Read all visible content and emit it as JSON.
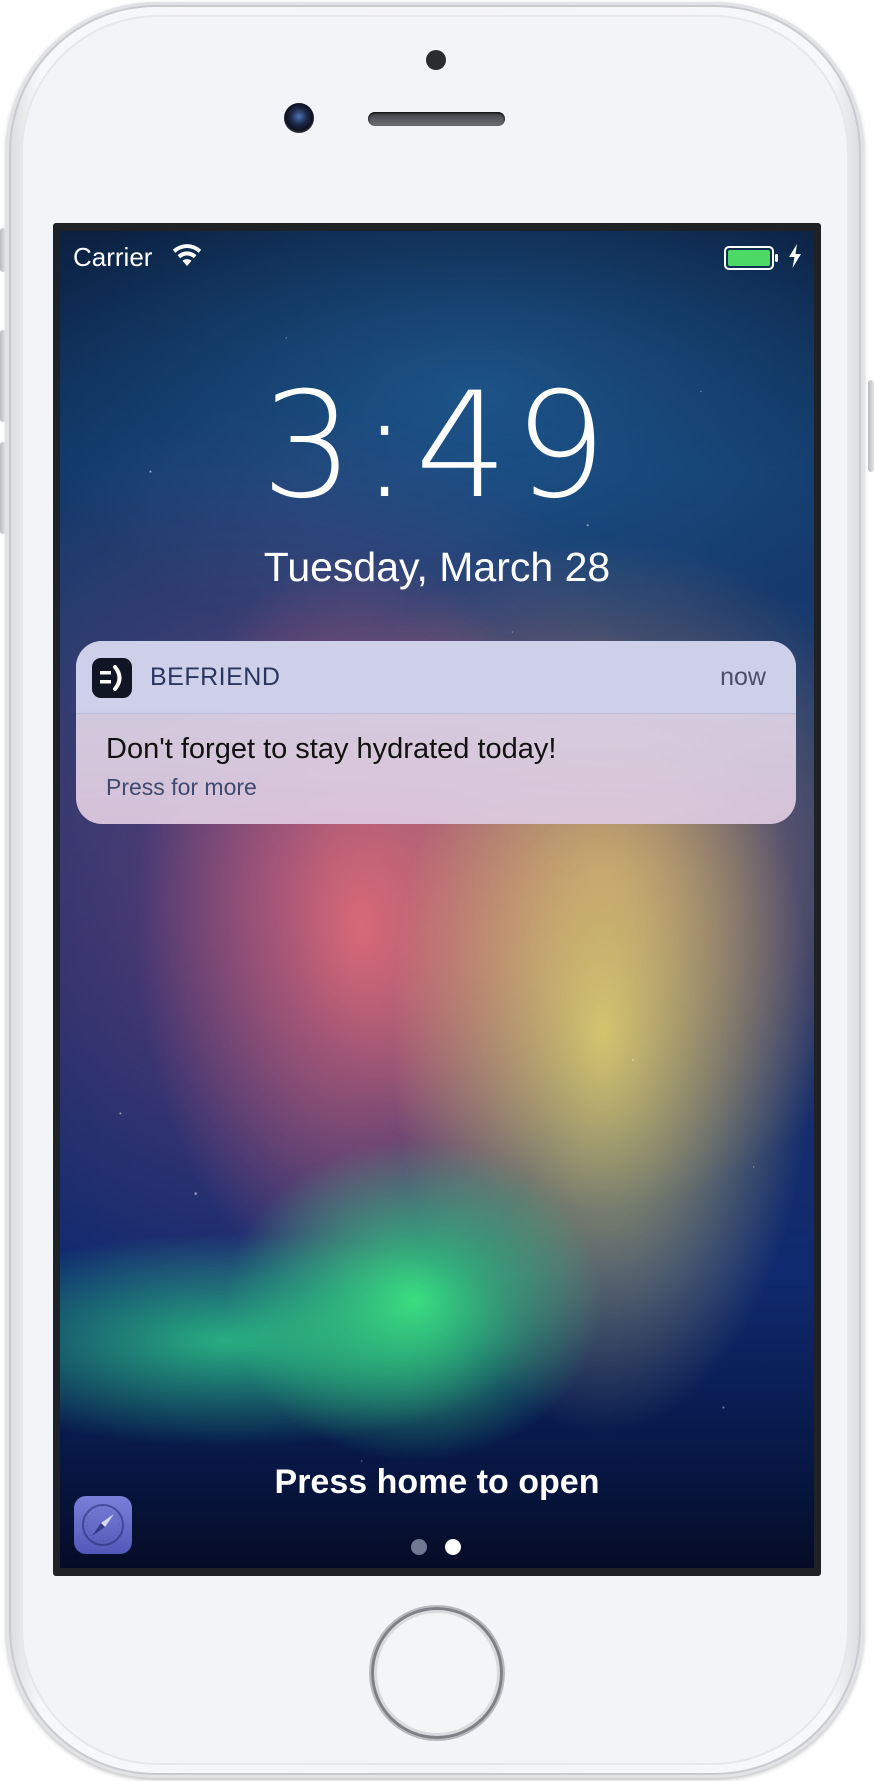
{
  "status_bar": {
    "carrier": "Carrier",
    "battery_color": "#4cd964"
  },
  "lock_screen": {
    "time": "3:49",
    "date": "Tuesday, March 28",
    "bottom_prompt": "Press home to open",
    "page_count": 2,
    "current_page": 2
  },
  "notification": {
    "app_name": "BEFRIEND",
    "time": "now",
    "message": "Don't forget to stay hydrated today!",
    "hint": "Press for more"
  },
  "icons": {
    "wifi": "wifi-icon",
    "battery": "battery-icon",
    "charging": "charging-bolt-icon",
    "app": "befriend-app-icon",
    "browser": "compass-browser-icon"
  }
}
